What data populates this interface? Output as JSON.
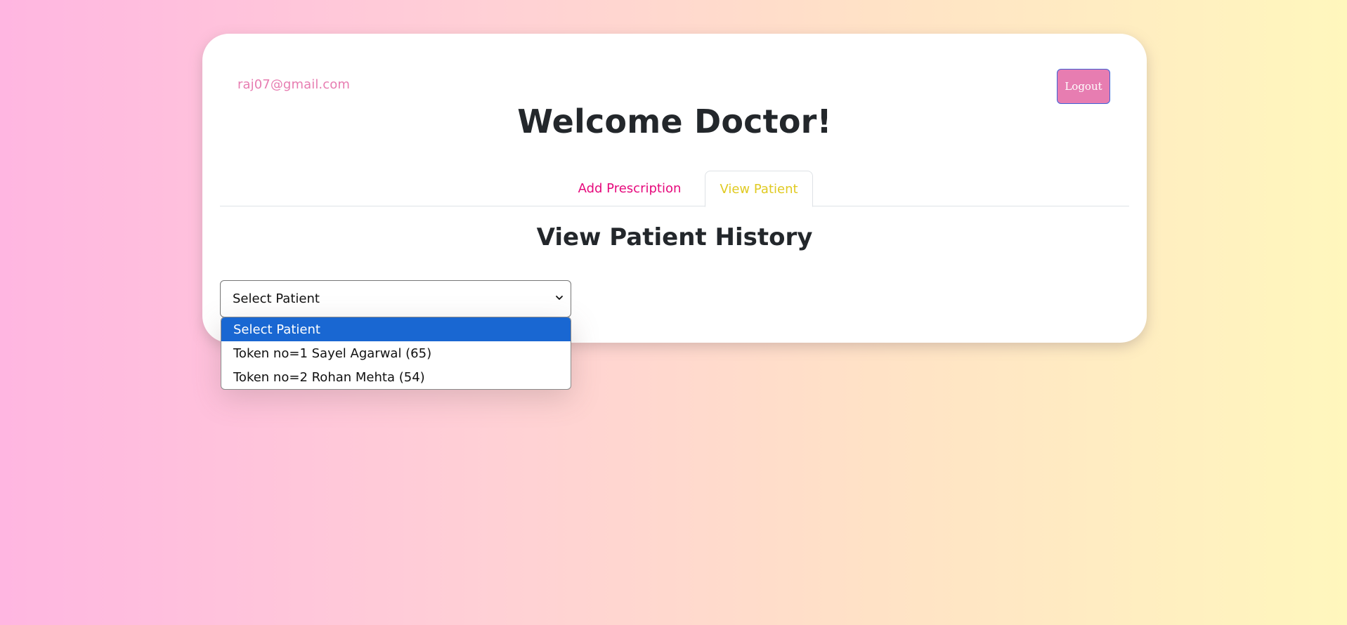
{
  "user": {
    "email": "raj07@gmail.com",
    "logout_label": "Logout"
  },
  "header": {
    "title": "Welcome Doctor!"
  },
  "tabs": [
    {
      "label": "Add Prescription",
      "active": false
    },
    {
      "label": "View Patient",
      "active": true
    }
  ],
  "main": {
    "section_title": "View Patient History",
    "select": {
      "selected_value": "Select Patient",
      "options": [
        {
          "label": "Select Patient",
          "highlighted": true
        },
        {
          "label": "Token no=1 Sayel Agarwal (65)",
          "highlighted": false
        },
        {
          "label": "Token no=2 Rohan Mehta (54)",
          "highlighted": false
        }
      ]
    }
  },
  "colors": {
    "accent_pink": "#e77db1",
    "tab_link": "#e6097c",
    "tab_active": "#e0ca22",
    "option_highlight": "#1967d2"
  },
  "icons": {
    "select_arrow": "chevron-down-icon"
  }
}
